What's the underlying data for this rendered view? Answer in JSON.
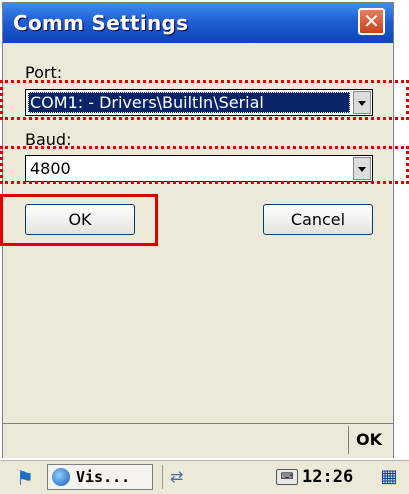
{
  "dialog": {
    "title": "Comm Settings",
    "close_glyph": "✕",
    "port_label": "Port:",
    "port_value": "COM1: - Drivers\\BuiltIn\\Serial",
    "baud_label": "Baud:",
    "baud_value": "4800",
    "ok_label": "OK",
    "cancel_label": "Cancel"
  },
  "softkey": {
    "ok_label": "OK"
  },
  "taskbar": {
    "start_icon": "windows-flag-icon",
    "task_label": "Vis...",
    "time": "12:26"
  },
  "colors": {
    "titlebar": "#1f5fd6",
    "highlight": "#e00000",
    "selection": "#0a246a"
  }
}
